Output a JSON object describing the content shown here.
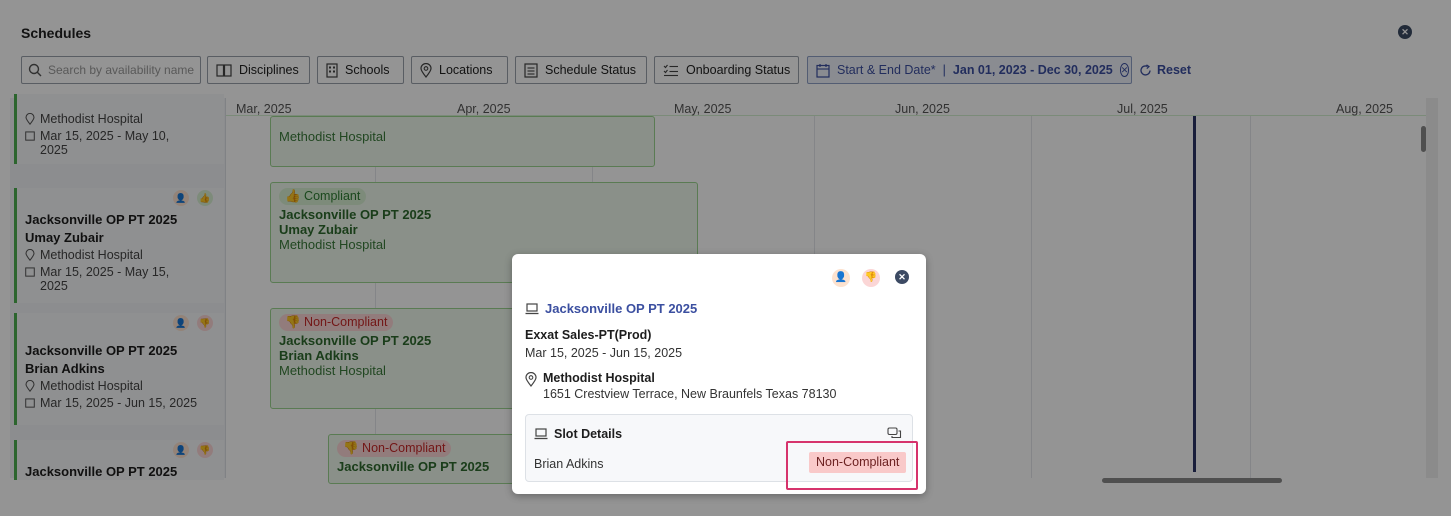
{
  "dialog": {
    "title": "Schedules"
  },
  "filters": {
    "search_placeholder": "Search by availability name",
    "disciplines": "Disciplines",
    "schools": "Schools",
    "locations": "Locations",
    "schedule_status": "Schedule Status",
    "onboarding_status": "Onboarding Status",
    "date_label": "Start & End Date*",
    "date_sep": "|",
    "date_value": "Jan 01, 2023 - Dec 30, 2025",
    "reset": "Reset"
  },
  "timeline": {
    "months": [
      "Mar, 2025",
      "Apr, 2025",
      "May, 2025",
      "Jun, 2025",
      "Jul, 2025",
      "Aug, 2025"
    ]
  },
  "left_cards": [
    {
      "location": "Methodist Hospital",
      "date": "Mar 15, 2025 - May 10, 2025"
    },
    {
      "title": "Jacksonville OP PT 2025",
      "person": "Umay Zubair",
      "location": "Methodist Hospital",
      "date": "Mar 15, 2025 - May 15, 2025"
    },
    {
      "title": "Jacksonville OP PT 2025",
      "person": "Brian Adkins",
      "location": "Methodist Hospital",
      "date": "Mar 15, 2025 - Jun 15, 2025"
    },
    {
      "title": "Jacksonville OP PT 2025"
    }
  ],
  "events": [
    {
      "location": "Methodist Hospital"
    },
    {
      "status": "Compliant",
      "title": "Jacksonville OP PT 2025",
      "person": "Umay Zubair",
      "location": "Methodist Hospital"
    },
    {
      "status": "Non-Compliant",
      "title": "Jacksonville OP PT 2025",
      "person": "Brian Adkins",
      "location": "Methodist Hospital"
    },
    {
      "status": "Non-Compliant",
      "title": "Jacksonville OP PT 2025"
    }
  ],
  "popover": {
    "title": "Jacksonville OP PT 2025",
    "org": "Exxat Sales-PT(Prod)",
    "dates": "Mar 15, 2025 - Jun 15, 2025",
    "location_name": "Methodist Hospital",
    "address": "1651 Crestview Terrace, New Braunfels Texas 78130",
    "slot": {
      "header": "Slot Details",
      "name": "Brian Adkins",
      "status": "Non-Compliant"
    }
  },
  "colors": {
    "accent": "#3b4fa0",
    "compliant": "#4caf50",
    "noncompliant": "#c62828",
    "highlight": "#d6336c"
  }
}
